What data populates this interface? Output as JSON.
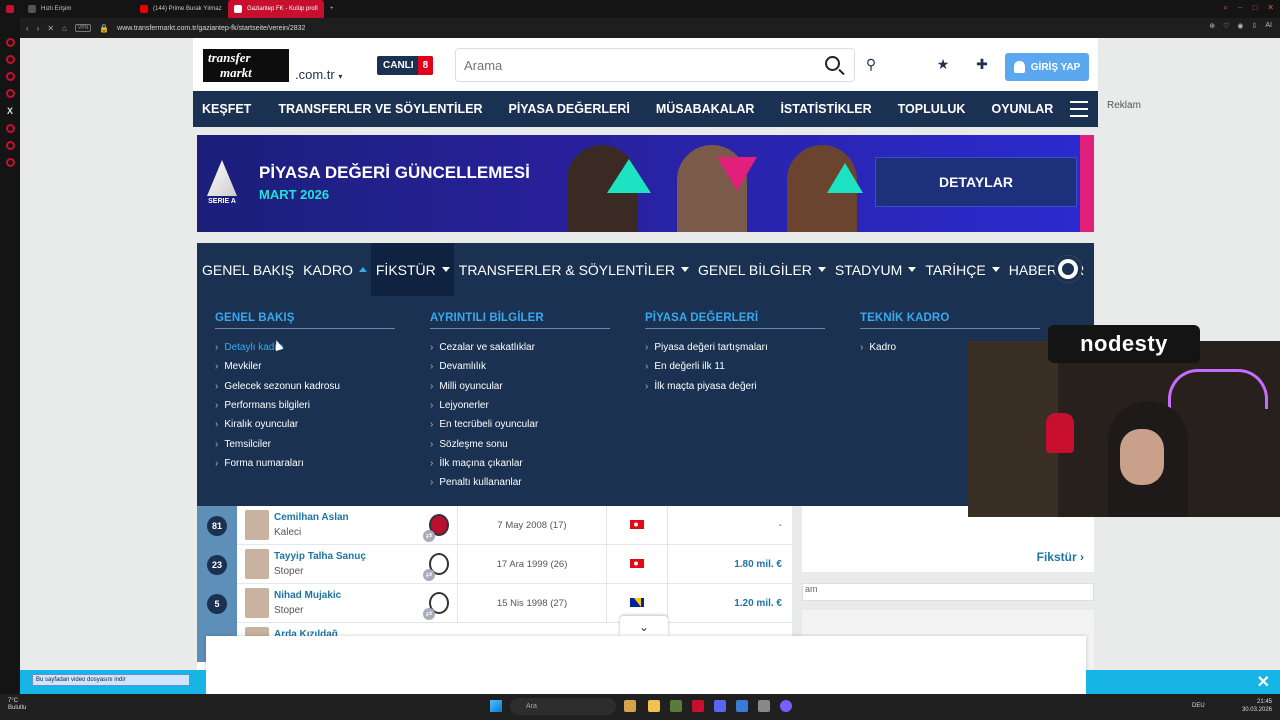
{
  "browser": {
    "tabs": [
      {
        "label": "Hızlı Erişim",
        "active": false
      },
      {
        "label": "(144) Prime Burak Yılmaz",
        "active": false
      },
      {
        "label": "Gaziantep FK - Kulüp profi",
        "active": true
      }
    ],
    "url": "www.transfermarkt.com.tr/gaziantep-fk/startseite/verein/2832",
    "vpn_label": "VPN"
  },
  "header": {
    "logo_line1": "transfer",
    "logo_line2": "markt",
    "domain": ".com.tr",
    "live_label": "CANLI",
    "live_count": "8",
    "search_placeholder": "Arama",
    "login_label": "GİRİŞ YAP",
    "ad_label": "Reklam"
  },
  "mainnav": [
    "KEŞFET",
    "TRANSFERLER VE SÖYLENTİLER",
    "PİYASA DEĞERLERİ",
    "MÜSABAKALAR",
    "İSTATİSTİKLER",
    "TOPLULUK",
    "OYUNLAR"
  ],
  "banner": {
    "league": "SERIE A",
    "title": "PİYASA DEĞERİ GÜNCELLEMESİ",
    "subtitle": "MART 2026",
    "button": "DETAYLAR"
  },
  "clubnav": [
    "GENEL BAKIŞ",
    "KADRO",
    "FİKSTÜR",
    "TRANSFERLER & SÖYLENTİLER",
    "GENEL BİLGİLER",
    "STADYUM",
    "TARİHÇE",
    "HABERLER"
  ],
  "mega": {
    "columns": [
      {
        "title": "GENEL BAKIŞ",
        "items": [
          "Detaylı kadro",
          "Mevkiler",
          "Gelecek sezonun kadrosu",
          "Performans bilgileri",
          "Kiralık oyuncular",
          "Temsilciler",
          "Forma numaraları"
        ]
      },
      {
        "title": "AYRINTILI BİLGİLER",
        "items": [
          "Cezalar ve sakatlıklar",
          "Devamlılık",
          "Milli oyuncular",
          "Lejyonerler",
          "En tecrübeli oyuncular",
          "Sözleşme sonu",
          "İlk maçına çıkanlar",
          "Penaltı kullananlar"
        ]
      },
      {
        "title": "PİYASA DEĞERLERİ",
        "items": [
          "Piyasa değeri tartışmaları",
          "En değerli ilk 11",
          "İlk maçta piyasa değeri"
        ]
      },
      {
        "title": "TEKNİK KADRO",
        "items": [
          "Kadro"
        ]
      }
    ]
  },
  "players": [
    {
      "number": "81",
      "name": "Cemilhan Aslan",
      "position": "Kaleci",
      "dob": "7 May 2008 (17)",
      "value": "-"
    },
    {
      "number": "23",
      "name": "Tayyip Talha Sanuç",
      "position": "Stoper",
      "dob": "17 Ara 1999 (26)",
      "value": "1.80 mil. €"
    },
    {
      "number": "5",
      "name": "Nihad Mujakic",
      "position": "Stoper",
      "dob": "15 Nis 1998 (27)",
      "value": "1.20 mil. €"
    },
    {
      "number": "",
      "name": "Arda Kızıldağ",
      "position": "",
      "dob": "",
      "value": ""
    }
  ],
  "right": {
    "fixture_link": "Fikstür",
    "select_text": "am"
  },
  "overlay": {
    "streamer": "nodesty",
    "download_bar": "Bu sayfadan video dosyasını indir"
  },
  "taskbar": {
    "temp": "7°C",
    "weather": "Bulutlu",
    "search": "Ara",
    "lang": "DEU",
    "time": "21:45",
    "date": "30.03.2026"
  },
  "colors": {
    "navy": "#1a3151",
    "accent_blue": "#39a8ef",
    "link_blue": "#1d75a3",
    "live_red": "#e1001a",
    "login_blue": "#5ba8f1",
    "tab_red": "#c8102e"
  }
}
